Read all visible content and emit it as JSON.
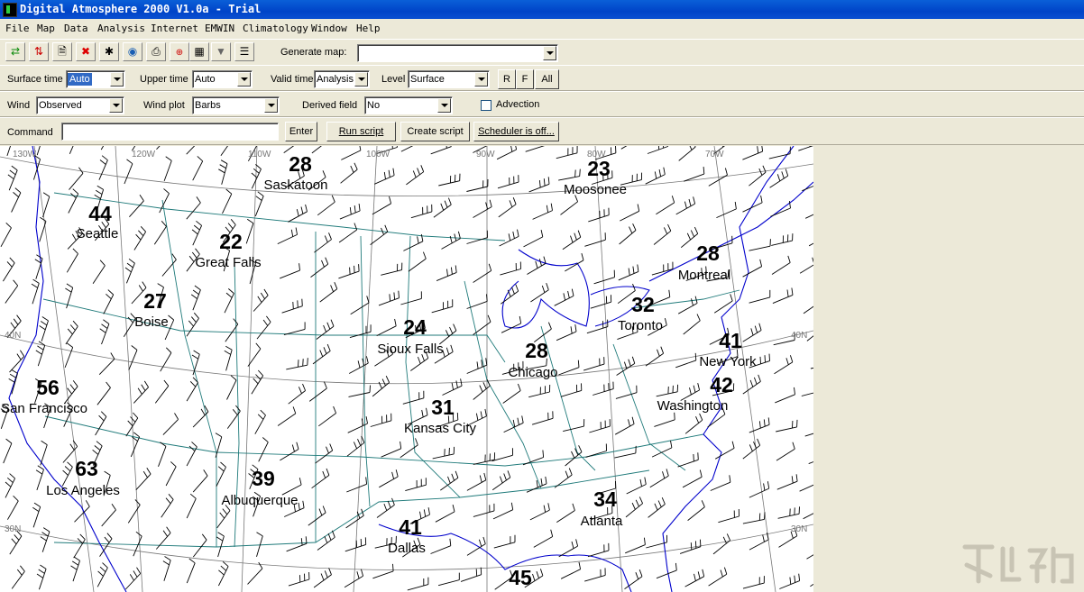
{
  "window": {
    "title": "Digital Atmosphere 2000 V1.0a - Trial"
  },
  "menu": [
    "File",
    "Map",
    "Data",
    "Analysis",
    "Internet",
    "EMWIN",
    "Climatology",
    "Window",
    "Help"
  ],
  "toolbar": {
    "buttons": [
      "open-data-icon",
      "download-icon",
      "new-map-icon",
      "delete-icon",
      "satellite-icon",
      "globe-icon",
      "print-icon",
      "zoom-icon",
      "calculator-icon",
      "filter-icon",
      "list-icon"
    ],
    "generate_label": "Generate map:",
    "generate_value": ""
  },
  "row1": {
    "surface_time_label": "Surface time",
    "surface_time_value": "Auto",
    "upper_time_label": "Upper time",
    "upper_time_value": "Auto",
    "valid_time_label": "Valid time",
    "valid_time_value": "Analysis",
    "level_label": "Level",
    "level_value": "Surface",
    "btn_r": "R",
    "btn_f": "F",
    "btn_all": "All"
  },
  "row2": {
    "wind_label": "Wind",
    "wind_value": "Observed",
    "wind_plot_label": "Wind plot",
    "wind_plot_value": "Barbs",
    "derived_label": "Derived field",
    "derived_value": "No",
    "advection_label": "Advection"
  },
  "row3": {
    "command_label": "Command",
    "command_value": "",
    "enter": "Enter",
    "run": "Run script",
    "create": "Create script",
    "scheduler": "Scheduler is off..."
  },
  "map": {
    "grid_labels": [
      "130W",
      "120W",
      "110W",
      "100W",
      "90W",
      "80W",
      "70W",
      "40N",
      "40N",
      "30N",
      "30N"
    ],
    "stations": [
      {
        "name": "Saskatoon",
        "value": "28"
      },
      {
        "name": "Moosonee",
        "value": "23"
      },
      {
        "name": "Seattle",
        "value": "44"
      },
      {
        "name": "Great Falls",
        "value": "22"
      },
      {
        "name": "Montreal",
        "value": "28"
      },
      {
        "name": "Boise",
        "value": "27"
      },
      {
        "name": "Toronto",
        "value": "32"
      },
      {
        "name": "Sioux Falls",
        "value": "24"
      },
      {
        "name": "Chicago",
        "value": "28"
      },
      {
        "name": "New York",
        "value": "41"
      },
      {
        "name": "San Francisco",
        "value": "56"
      },
      {
        "name": "Washington",
        "value": "42"
      },
      {
        "name": "Kansas City",
        "value": "31"
      },
      {
        "name": "Los Angeles",
        "value": "63"
      },
      {
        "name": "Albuquerque",
        "value": "39"
      },
      {
        "name": "Atlanta",
        "value": "34"
      },
      {
        "name": "Dallas",
        "value": "41"
      },
      {
        "name": "",
        "value": "45"
      }
    ]
  }
}
